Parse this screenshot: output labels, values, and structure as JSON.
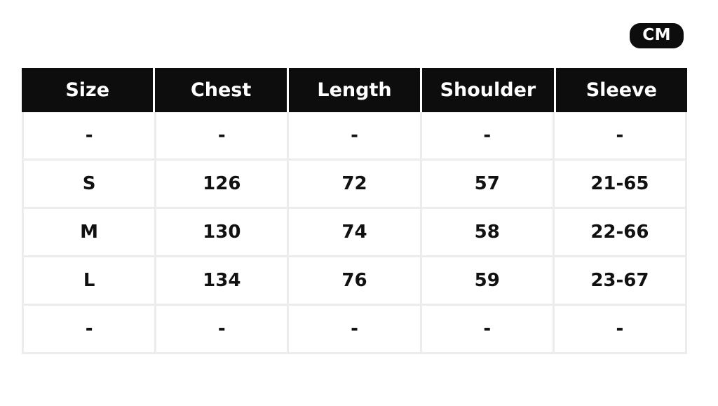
{
  "unit_badge": {
    "label": "CM"
  },
  "colors": {
    "header_background": "#0d0d0d",
    "header_text": "#ffffff",
    "grid_line": "#ececec",
    "body_text": "#111111",
    "page_background": "#ffffff"
  },
  "size_table": {
    "columns": [
      "Size",
      "Chest",
      "Length",
      "Shoulder",
      "Sleeve"
    ],
    "rows": [
      {
        "size": "-",
        "chest": "-",
        "length": "-",
        "shoulder": "-",
        "sleeve": "-"
      },
      {
        "size": "S",
        "chest": "126",
        "length": "72",
        "shoulder": "57",
        "sleeve": "21-65"
      },
      {
        "size": "M",
        "chest": "130",
        "length": "74",
        "shoulder": "58",
        "sleeve": "22-66"
      },
      {
        "size": "L",
        "chest": "134",
        "length": "76",
        "shoulder": "59",
        "sleeve": "23-67"
      },
      {
        "size": "-",
        "chest": "-",
        "length": "-",
        "shoulder": "-",
        "sleeve": "-"
      }
    ]
  }
}
